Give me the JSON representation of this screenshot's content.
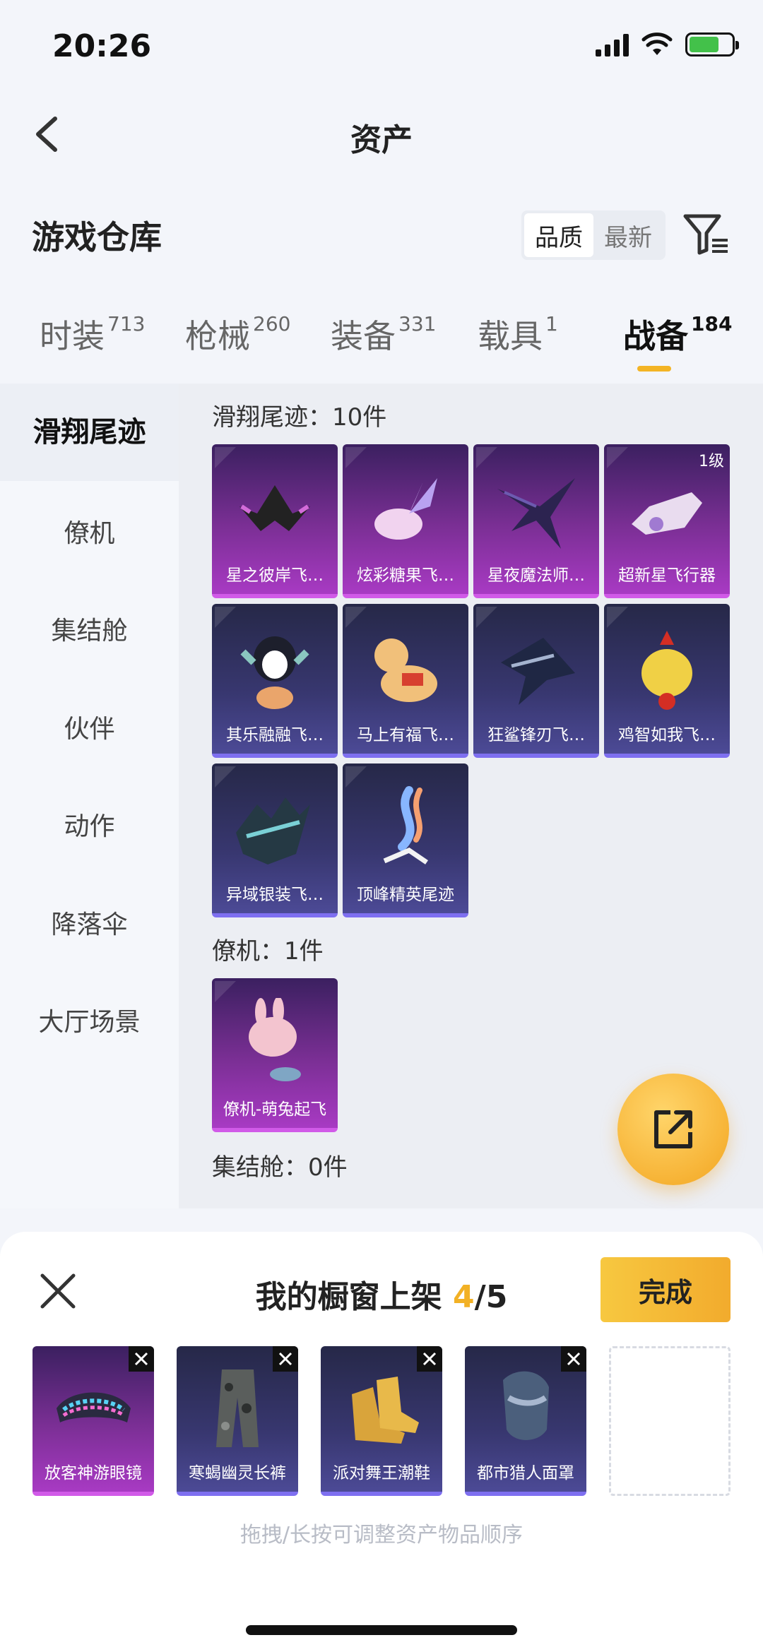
{
  "status": {
    "time": "20:26"
  },
  "header": {
    "title": "资产"
  },
  "warehouse": {
    "title": "游戏仓库",
    "sort_options": [
      "品质",
      "最新"
    ]
  },
  "tabs": [
    {
      "label": "时装",
      "count": "713"
    },
    {
      "label": "枪械",
      "count": "260"
    },
    {
      "label": "装备",
      "count": "331"
    },
    {
      "label": "载具",
      "count": "1"
    },
    {
      "label": "战备",
      "count": "184"
    }
  ],
  "sidebar": {
    "items": [
      "滑翔尾迹",
      "僚机",
      "集结舱",
      "伙伴",
      "动作",
      "降落伞",
      "大厅场景"
    ]
  },
  "sections": [
    {
      "title": "滑翔尾迹：10件",
      "items": [
        {
          "label": "星之彼岸飞…",
          "rarity": "purple"
        },
        {
          "label": "炫彩糖果飞…",
          "rarity": "purple"
        },
        {
          "label": "星夜魔法师…",
          "rarity": "purple"
        },
        {
          "label": "超新星飞行器",
          "rarity": "purple",
          "level": "1级"
        },
        {
          "label": "其乐融融飞…",
          "rarity": "blue"
        },
        {
          "label": "马上有福飞…",
          "rarity": "blue"
        },
        {
          "label": "狂鲨锋刃飞…",
          "rarity": "blue"
        },
        {
          "label": "鸡智如我飞…",
          "rarity": "blue"
        },
        {
          "label": "异域银装飞…",
          "rarity": "blue"
        },
        {
          "label": "顶峰精英尾迹",
          "rarity": "blue"
        }
      ]
    },
    {
      "title": "僚机：1件",
      "items": [
        {
          "label": "僚机-萌兔起飞",
          "rarity": "purple"
        }
      ]
    },
    {
      "title": "集结舱：0件",
      "items": []
    }
  ],
  "showcase": {
    "title_prefix": "我的橱窗上架 ",
    "count": "4",
    "total": "/5",
    "done_label": "完成",
    "items": [
      {
        "label": "放客神游眼镜",
        "rarity": "purple"
      },
      {
        "label": "寒蝎幽灵长裤",
        "rarity": "blue"
      },
      {
        "label": "派对舞王潮鞋",
        "rarity": "blue"
      },
      {
        "label": "都市猎人面罩",
        "rarity": "blue"
      }
    ],
    "hint": "拖拽/长按可调整资产物品顺序"
  },
  "icons": {
    "back": "chevron-left-icon",
    "filter": "filter-icon",
    "share": "share-external-icon",
    "close": "close-icon",
    "remove": "remove-x-icon"
  },
  "colors": {
    "accent": "#f3b425",
    "purple_rarity": "#a83ac3",
    "blue_rarity": "#4c4a96"
  }
}
